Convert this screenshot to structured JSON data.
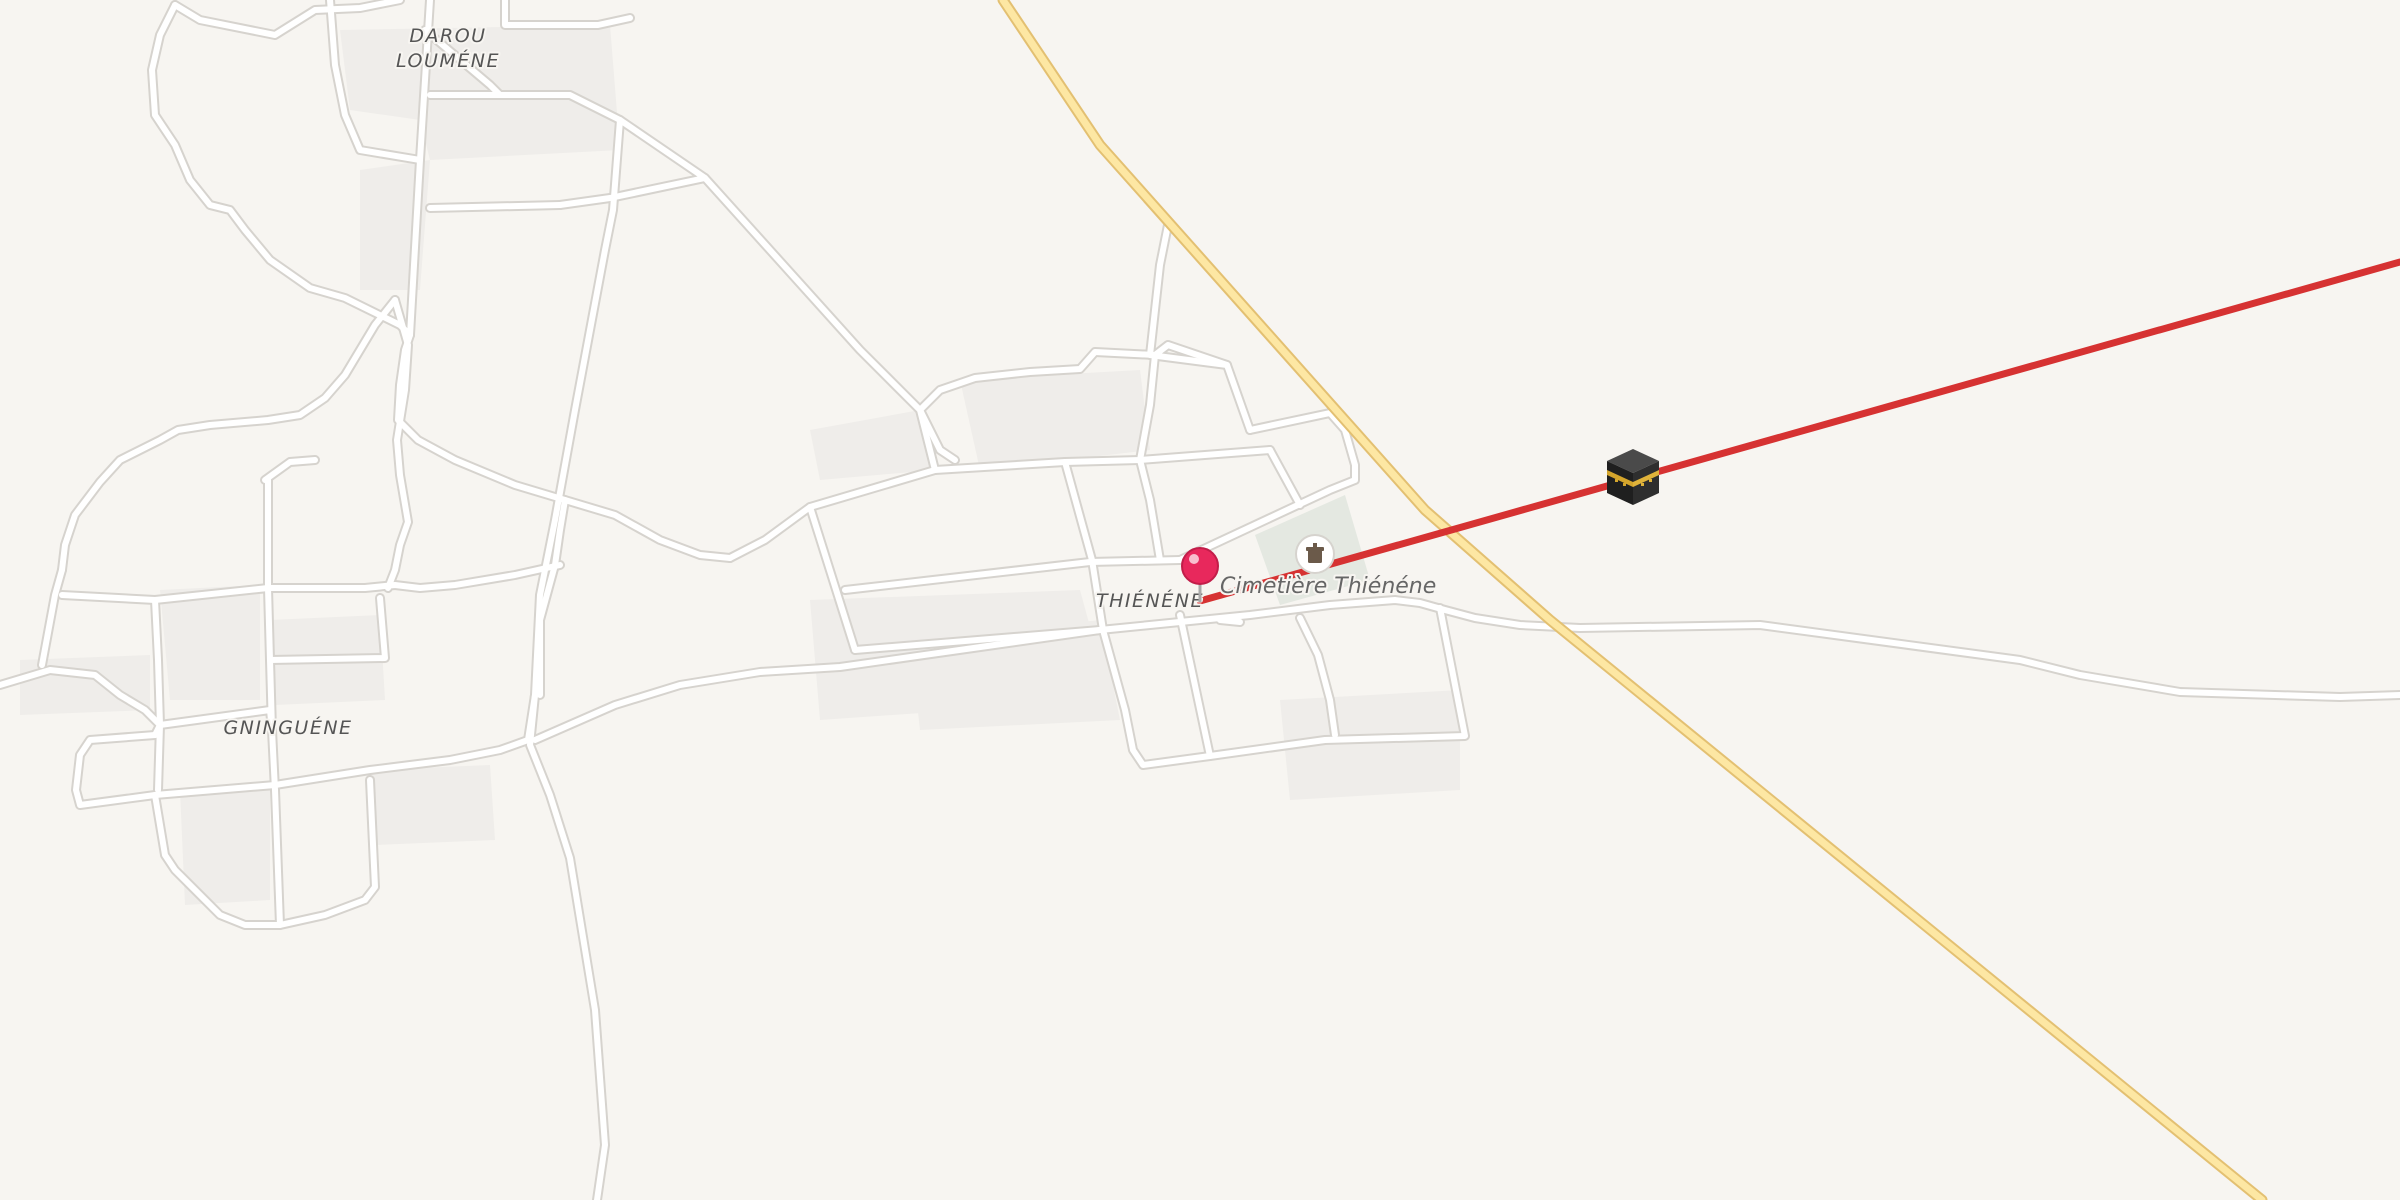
{
  "map": {
    "places": [
      {
        "id": "darou-loumene",
        "lines": [
          "DAROU",
          "LOUMÉNE"
        ]
      },
      {
        "id": "gninguene",
        "lines": [
          "GNINGUÉNE"
        ]
      },
      {
        "id": "thienene",
        "lines": [
          "THIÉNÉNE"
        ]
      }
    ],
    "poi": {
      "label": "Cimetière Thiénéne",
      "icon": "cemetery-icon"
    },
    "markers": {
      "location_pin": {
        "icon": "location-pin-icon",
        "color": "#e8285c"
      },
      "destination": {
        "icon": "kaaba-icon"
      }
    },
    "colors": {
      "background": "#f7f5f1",
      "road": "#ffffff",
      "road_casing": "#d6d3ce",
      "highway": "#fde7a3",
      "highway_casing": "#e3c072",
      "bearing_line": "#d63232",
      "cemetery_area": "#e4e8e1"
    }
  }
}
